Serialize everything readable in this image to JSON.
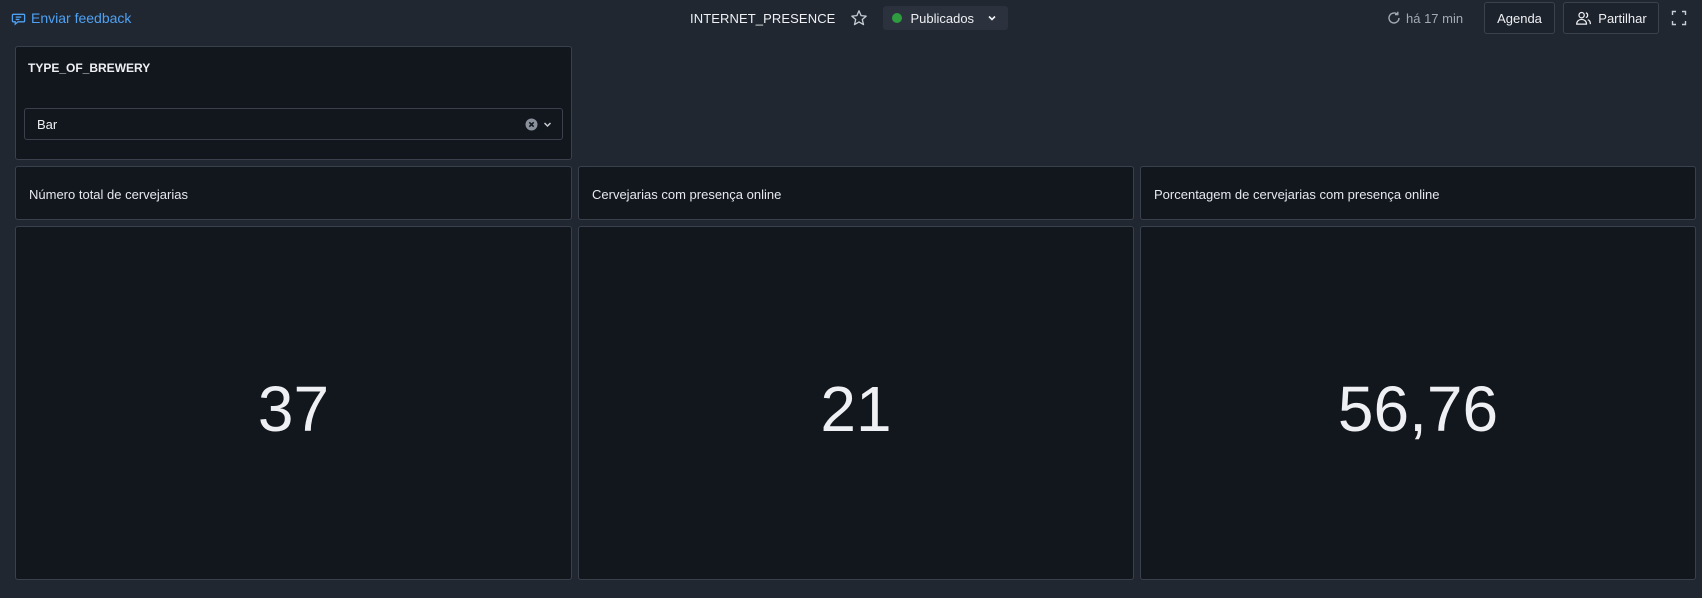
{
  "topbar": {
    "feedback_label": "Enviar feedback",
    "dashboard_title": "INTERNET_PRESENCE",
    "status_label": "Publicados",
    "status_color": "#2e9c3f",
    "refresh_label": "há 17 min",
    "agenda_label": "Agenda",
    "share_label": "Partilhar",
    "icons": [
      "feedback-icon",
      "star-icon",
      "chevron-down-icon",
      "refresh-icon",
      "share-users-icon",
      "fullscreen-icon"
    ]
  },
  "filter": {
    "label": "TYPE_OF_BREWERY",
    "selected_value": "Bar"
  },
  "panels": [
    {
      "title": "Número total de cervejarias",
      "value": "37"
    },
    {
      "title": "Cervejarias com presença online",
      "value": "21"
    },
    {
      "title": "Porcentagem de cervejarias com presença online",
      "value": "56,76"
    }
  ]
}
